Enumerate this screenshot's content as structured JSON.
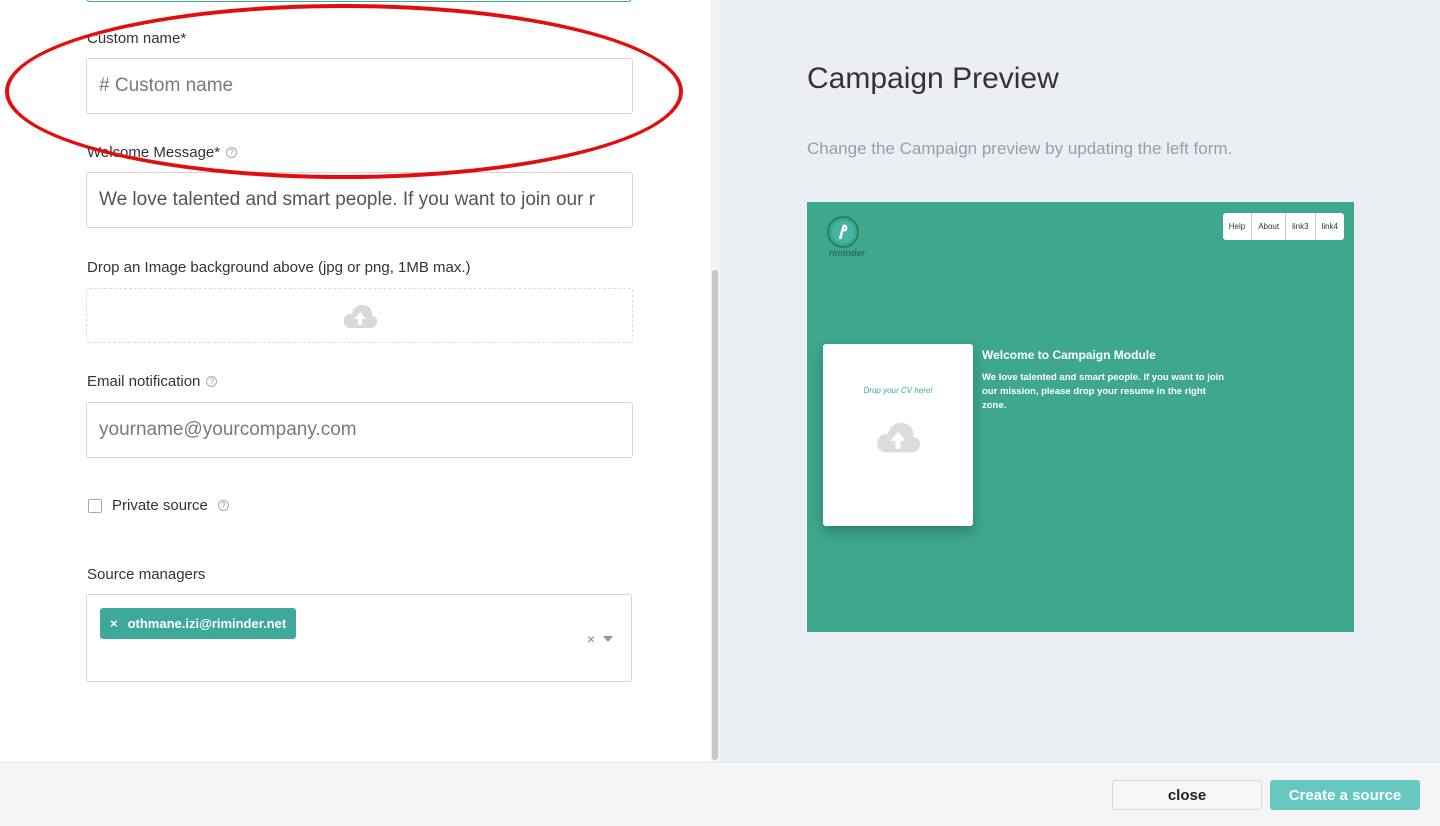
{
  "form": {
    "custom_name": {
      "label": "Custom name*",
      "placeholder": "# Custom name",
      "value": ""
    },
    "welcome_message": {
      "label": "Welcome Message*",
      "value": "We love talented and smart people. If you want to join our r"
    },
    "image_background": {
      "label": "Drop an Image background above (jpg or png, 1MB max.)"
    },
    "email_notification": {
      "label": "Email notification",
      "placeholder": "yourname@yourcompany.com"
    },
    "private_source": {
      "label": "Private source",
      "checked": false
    },
    "source_managers": {
      "label": "Source managers",
      "tags": [
        "othmane.izi@riminder.net"
      ],
      "clear_symbol": "×",
      "tag_remove_symbol": "×"
    },
    "help_symbol": "?"
  },
  "preview": {
    "title": "Campaign Preview",
    "subtitle": "Change the Campaign preview by updating the left form.",
    "logo_text": "riminder",
    "nav_links": [
      "Help",
      "About",
      "link3",
      "link4"
    ],
    "drop_text": "Drop your CV here!",
    "welcome_title": "Welcome to Campaign Module",
    "welcome_message": "We love talented and smart people. If you want to join our mission, please drop your resume in the right zone.",
    "background_color": "#3ea88e"
  },
  "footer": {
    "close_label": "close",
    "create_label": "Create a source"
  },
  "annotation": {
    "color": "#e40d0d",
    "shape": "ellipse"
  },
  "icons": [
    "cloud-upload-icon",
    "help-icon",
    "chevron-down-icon",
    "close-icon",
    "riminder-logo-icon"
  ]
}
